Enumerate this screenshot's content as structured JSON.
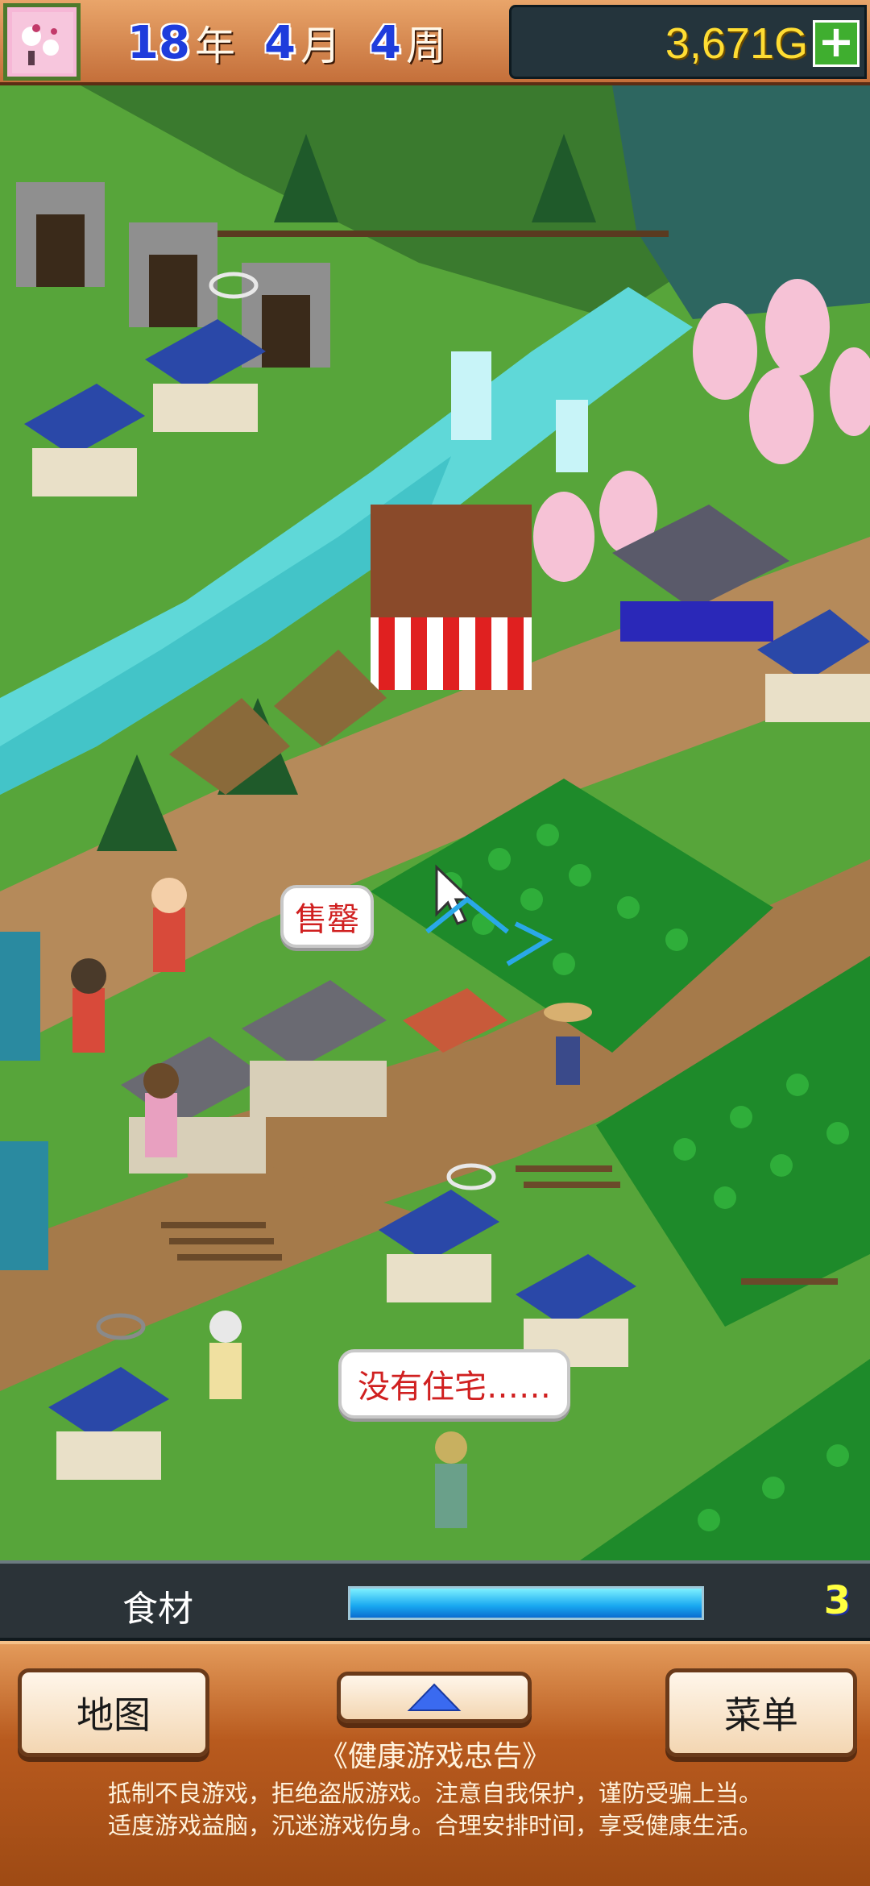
{
  "topbar": {
    "year": "18",
    "year_unit": "年",
    "month": "4",
    "month_unit": "月",
    "week": "4",
    "week_unit": "周",
    "gold": "3,671G",
    "add_gold_icon": "plus-icon",
    "avatar_icon": "sakura-portrait-icon"
  },
  "map": {
    "bubble_sale": "售罄",
    "bubble_house": "没有住宅……",
    "cursor_icon": "pointer-cursor-icon"
  },
  "status": {
    "label": "食材",
    "count": "3",
    "progress": 1.0,
    "bar_color": "#18a8f0"
  },
  "bottom": {
    "map_button": "地图",
    "menu_button": "菜单",
    "expand_icon": "triangle-up-icon",
    "health_title": "《健康游戏忠告》",
    "health_line1": "抵制不良游戏，拒绝盗版游戏。注意自我保护，谨防受骗上当。",
    "health_line2": "适度游戏益脑，沉迷游戏伤身。合理安排时间，享受健康生活。"
  },
  "colors": {
    "grass": "#5aa83a",
    "dirt": "#b58a5a",
    "river": "#5fd8d8",
    "roof_blue": "#2a48a8",
    "crop": "#1e8a2a"
  }
}
